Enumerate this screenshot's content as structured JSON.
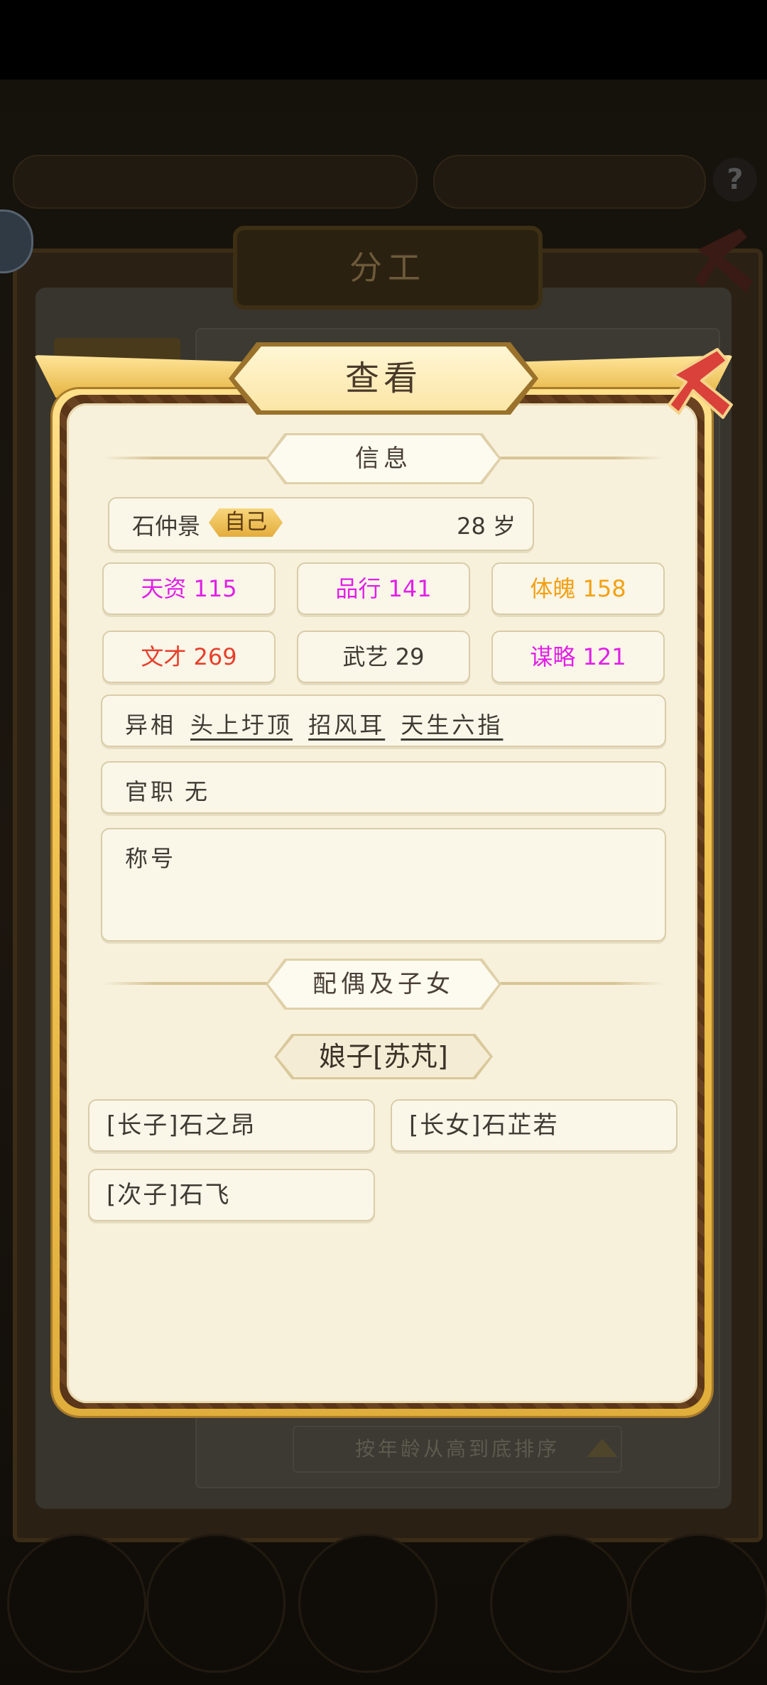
{
  "background": {
    "panel_title": "分工",
    "sort_label": "按年龄从高到底排序"
  },
  "dialog": {
    "title": "查看",
    "info_header": "信息",
    "name": "石仲景",
    "self_badge": "自己",
    "age": "28 岁",
    "stats": [
      {
        "label": "天资",
        "value": "115",
        "color": "#e020e6"
      },
      {
        "label": "品行",
        "value": "141",
        "color": "#e020e6"
      },
      {
        "label": "体魄",
        "value": "158",
        "color": "#f2a114"
      },
      {
        "label": "文才",
        "value": "269",
        "color": "#e6402c"
      },
      {
        "label": "武艺",
        "value": "29",
        "color": "#3f3a33"
      },
      {
        "label": "谋略",
        "value": "121",
        "color": "#e020e6"
      }
    ],
    "traits_label": "异相",
    "traits": [
      "头上圩顶",
      "招风耳",
      "天生六指"
    ],
    "office_label": "官职",
    "office_value": "无",
    "titles_label": "称号",
    "family_header": "配偶及子女",
    "spouse": "娘子[苏芃]",
    "children": [
      "[长子]石之昂",
      "[长女]石芷若",
      "[次子]石飞"
    ]
  },
  "colors": {
    "frame_gold": "#f1c451",
    "frame_dark": "#5a3518",
    "body_bg": "#f7f1dc",
    "close_red": "#d9413a"
  },
  "icons": [
    "close-icon",
    "microphone-icon",
    "help-icon"
  ]
}
